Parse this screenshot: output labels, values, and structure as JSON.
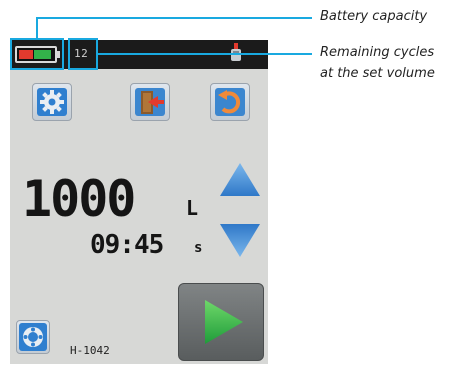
{
  "status_bar": {
    "remaining_cycles": "12"
  },
  "display": {
    "volume_value": "1000",
    "volume_unit": "L",
    "time_value": "09:45",
    "time_unit": "s"
  },
  "device": {
    "id": "H-1042"
  },
  "annotations": {
    "battery_label": "Battery capacity",
    "cycles_label_line1": "Remaining cycles",
    "cycles_label_line2": "at the set volume"
  },
  "colors": {
    "callout": "#19a9e0",
    "battery_low": "#e23a2e",
    "battery_full": "#33b34a",
    "arrow_blue": "#3a88d6",
    "play_green": "#33b84a"
  },
  "icons": {
    "settings": "gear-icon",
    "exit": "door-exit-icon",
    "reset": "return-arrow-icon",
    "increase": "triangle-up-icon",
    "decrease": "triangle-down-icon",
    "start": "play-icon",
    "connection": "connector-icon",
    "nozzle": "nozzle-icon"
  }
}
